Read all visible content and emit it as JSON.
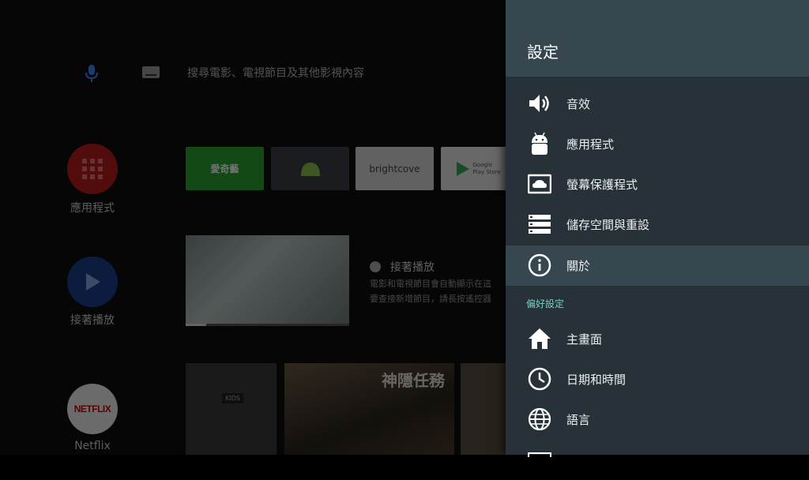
{
  "search": {
    "placeholder": "搜尋電影、電視節目及其他影視內容"
  },
  "launcher": {
    "apps_label": "應用程式",
    "play_next_label": "接著播放",
    "netflix_label": "Netflix",
    "netflix_logo": "NETFLIX",
    "tiles": {
      "iqiyi": "愛奇藝",
      "brightcove": "brightcove",
      "google_play": "Google Play Store"
    },
    "continue": {
      "title": "接著播放",
      "desc_line1": "電影和電視節目會自動顯示在這",
      "desc_line2": "要查接新增節目，請長按遙控器"
    },
    "poster_title": "神隱任務",
    "poster_kids": "KIDS"
  },
  "settings": {
    "title": "設定",
    "items": [
      {
        "label": "音效",
        "icon": "volume-icon"
      },
      {
        "label": "應用程式",
        "icon": "android-icon"
      },
      {
        "label": "螢幕保護程式",
        "icon": "screensaver-icon"
      },
      {
        "label": "儲存空間與重設",
        "icon": "storage-icon"
      },
      {
        "label": "關於",
        "icon": "info-icon",
        "focused": true
      }
    ],
    "section_preferences": "偏好設定",
    "pref_items": [
      {
        "label": "主畫面",
        "icon": "home-icon"
      },
      {
        "label": "日期和時間",
        "icon": "clock-icon"
      },
      {
        "label": "語言",
        "icon": "globe-icon"
      }
    ]
  },
  "colors": {
    "panel_bg": "#263238",
    "panel_header": "#37474f",
    "accent_teal": "#80cbc4",
    "mic_blue": "#4285f4"
  }
}
